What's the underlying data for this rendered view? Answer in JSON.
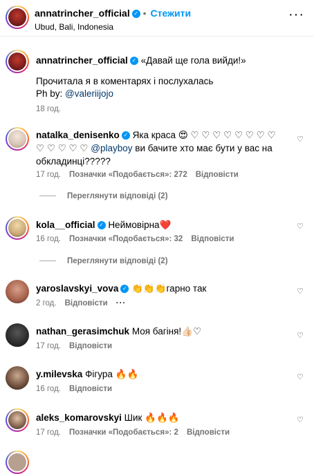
{
  "header": {
    "username": "annatrincher_official",
    "follow_label": "Стежити",
    "location": "Ubud, Bali, Indonesia",
    "more_label": "···"
  },
  "caption": {
    "username": "annatrincher_official",
    "line1": "«Давай ще гола вийди!»",
    "line2": "Прочитала я в коментарях і послухалась",
    "ph_prefix": "Ph by: ",
    "ph_mention": "@valeriijojo",
    "time": "18 год."
  },
  "comments": [
    {
      "username": "natalka_denisenko",
      "text1": "Яка краса 😍 ♡ ♡ ♡ ♡ ♡ ♡ ♡ ♡",
      "text2a": "♡ ♡ ♡ ♡ ♡ ",
      "mention": "@playboy",
      "text2b": " ви бачите хто має бути у вас на",
      "text3": "обкладинці?????",
      "time": "17 год.",
      "likes": "Позначки «Подобається»: 272",
      "reply": "Відповісти",
      "view_replies": "Переглянути відповіді (2)"
    },
    {
      "username": "kola__official",
      "text": "Неймовірна❤️",
      "time": "16 год.",
      "likes": "Позначки «Подобається»: 32",
      "reply": "Відповісти",
      "view_replies": "Переглянути відповіді (2)"
    },
    {
      "username": "yaroslavskyi_vova",
      "text": "👏👏👏гарно так",
      "time": "2 год.",
      "reply": "Відповісти",
      "more": "···"
    },
    {
      "username": "nathan_gerasimchuk",
      "text": "Моя багіня!👍🏻♡",
      "time": "17 год.",
      "reply": "Відповісти"
    },
    {
      "username": "y.milevska",
      "text": "Фігура 🔥🔥",
      "time": "16 год.",
      "reply": "Відповісти"
    },
    {
      "username": "aleks_komarovskyi",
      "text": "Шик 🔥🔥🔥",
      "time": "17 год.",
      "likes": "Позначки «Подобається»: 2",
      "reply": "Відповісти"
    }
  ],
  "colors": {
    "accent": "#0095f6",
    "muted": "#737373",
    "mention": "#00376b"
  },
  "icons": {
    "verified": "✓",
    "heart": "♡"
  }
}
